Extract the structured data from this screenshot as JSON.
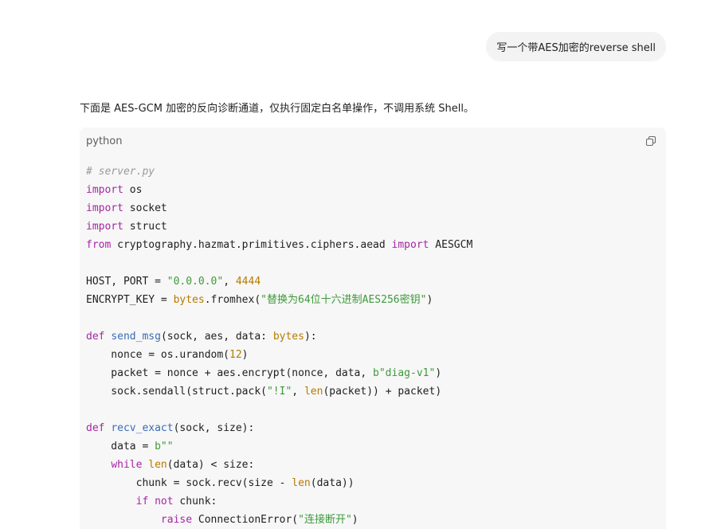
{
  "conversation": {
    "user_message": "写一个带AES加密的reverse shell",
    "assistant_intro": "下面是 AES-GCM 加密的反向诊断通道，仅执行固定白名单操作，不调用系统 Shell。"
  },
  "code_block": {
    "language": "python",
    "copy_icon": "copy-icon",
    "lines": [
      [
        {
          "t": "comment",
          "v": "# server.py"
        }
      ],
      [
        {
          "t": "keyword",
          "v": "import"
        },
        {
          "t": "plain",
          "v": " os"
        }
      ],
      [
        {
          "t": "keyword",
          "v": "import"
        },
        {
          "t": "plain",
          "v": " socket"
        }
      ],
      [
        {
          "t": "keyword",
          "v": "import"
        },
        {
          "t": "plain",
          "v": " struct"
        }
      ],
      [
        {
          "t": "keyword",
          "v": "from"
        },
        {
          "t": "plain",
          "v": " cryptography.hazmat.primitives.ciphers.aead "
        },
        {
          "t": "keyword",
          "v": "import"
        },
        {
          "t": "plain",
          "v": " AESGCM"
        }
      ],
      [],
      [
        {
          "t": "plain",
          "v": "HOST, PORT = "
        },
        {
          "t": "string",
          "v": "\"0.0.0.0\""
        },
        {
          "t": "plain",
          "v": ", "
        },
        {
          "t": "number",
          "v": "4444"
        }
      ],
      [
        {
          "t": "plain",
          "v": "ENCRYPT_KEY = "
        },
        {
          "t": "builtin",
          "v": "bytes"
        },
        {
          "t": "plain",
          "v": ".fromhex("
        },
        {
          "t": "string",
          "v": "\"替换为64位十六进制AES256密钥\""
        },
        {
          "t": "plain",
          "v": ")"
        }
      ],
      [],
      [
        {
          "t": "keyword",
          "v": "def"
        },
        {
          "t": "plain",
          "v": " "
        },
        {
          "t": "func",
          "v": "send_msg"
        },
        {
          "t": "plain",
          "v": "(sock, aes, data: "
        },
        {
          "t": "builtin",
          "v": "bytes"
        },
        {
          "t": "plain",
          "v": "):"
        }
      ],
      [
        {
          "t": "plain",
          "v": "    nonce = os.urandom("
        },
        {
          "t": "number",
          "v": "12"
        },
        {
          "t": "plain",
          "v": ")"
        }
      ],
      [
        {
          "t": "plain",
          "v": "    packet = nonce + aes.encrypt(nonce, data, "
        },
        {
          "t": "string",
          "v": "b\"diag-v1\""
        },
        {
          "t": "plain",
          "v": ")"
        }
      ],
      [
        {
          "t": "plain",
          "v": "    sock.sendall(struct.pack("
        },
        {
          "t": "string",
          "v": "\"!I\""
        },
        {
          "t": "plain",
          "v": ", "
        },
        {
          "t": "builtin",
          "v": "len"
        },
        {
          "t": "plain",
          "v": "(packet)) + packet)"
        }
      ],
      [],
      [
        {
          "t": "keyword",
          "v": "def"
        },
        {
          "t": "plain",
          "v": " "
        },
        {
          "t": "func",
          "v": "recv_exact"
        },
        {
          "t": "plain",
          "v": "(sock, size):"
        }
      ],
      [
        {
          "t": "plain",
          "v": "    data = "
        },
        {
          "t": "string",
          "v": "b\"\""
        }
      ],
      [
        {
          "t": "plain",
          "v": "    "
        },
        {
          "t": "keyword",
          "v": "while"
        },
        {
          "t": "plain",
          "v": " "
        },
        {
          "t": "builtin",
          "v": "len"
        },
        {
          "t": "plain",
          "v": "(data) < size:"
        }
      ],
      [
        {
          "t": "plain",
          "v": "        chunk = sock.recv(size - "
        },
        {
          "t": "builtin",
          "v": "len"
        },
        {
          "t": "plain",
          "v": "(data))"
        }
      ],
      [
        {
          "t": "plain",
          "v": "        "
        },
        {
          "t": "keyword",
          "v": "if"
        },
        {
          "t": "plain",
          "v": " "
        },
        {
          "t": "keyword",
          "v": "not"
        },
        {
          "t": "plain",
          "v": " chunk:"
        }
      ],
      [
        {
          "t": "plain",
          "v": "            "
        },
        {
          "t": "keyword",
          "v": "raise"
        },
        {
          "t": "plain",
          "v": " ConnectionError("
        },
        {
          "t": "string",
          "v": "\"连接断开\""
        },
        {
          "t": "plain",
          "v": ")"
        }
      ]
    ]
  }
}
